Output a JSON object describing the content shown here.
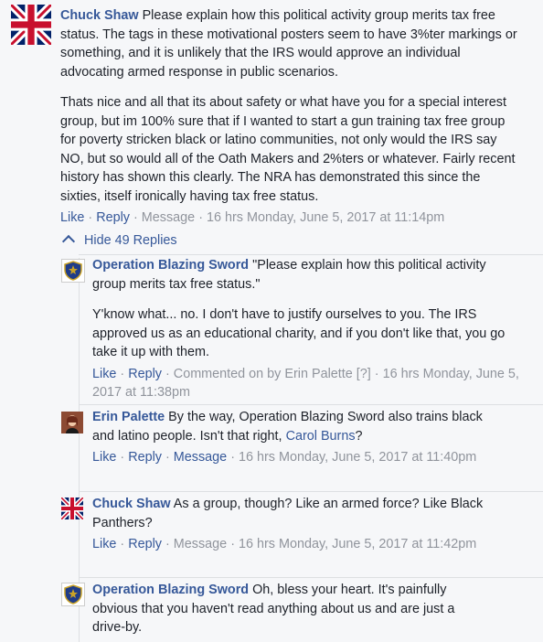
{
  "comments": {
    "c1": {
      "author": "Chuck Shaw",
      "text_para1": " Please explain how this political activity group merits tax free status. The tags in these motivational posters seem to have 3%ter markings or something, and it is unlikely that the IRS would approve an individual advocating armed response in public scenarios.",
      "text_para2": "Thats nice and all that its about safety or what have you for a special interest group, but im 100% sure that if I wanted to start a gun training tax free group for poverty stricken black or latino communities, not only would the IRS say NO, but so would all of the Oath Makers and 2%ters or whatever. Fairly recent history has shown this clearly. The NRA has demonstrated this since the sixties, itself ironically having tax free status.",
      "actions": {
        "like": "Like",
        "reply": "Reply",
        "message": "Message",
        "age": "16 hrs",
        "timestamp": "Monday, June 5, 2017 at 11:14pm"
      }
    },
    "hide_replies": "Hide 49 Replies",
    "r1": {
      "author": "Operation Blazing Sword",
      "text_para1": " \"Please explain how this political activity group merits tax free status.\"",
      "text_para2": "Y'know what... no. I don't have to justify ourselves to you. The IRS approved us as an educational charity, and if you don't like that, you go take it up with them.",
      "actions": {
        "like": "Like",
        "reply": "Reply",
        "commented_on_by": "Commented on by Erin Palette [?]",
        "age": "16 hrs",
        "timestamp": "Monday, June 5, 2017 at 11:38pm"
      }
    },
    "r2": {
      "author": "Erin Palette",
      "text": " By the way, Operation Blazing Sword also trains black and latino people. Isn't that right, ",
      "mention": "Carol Burns",
      "text_end": "?",
      "actions": {
        "like": "Like",
        "reply": "Reply",
        "message": "Message",
        "age": "16 hrs",
        "timestamp": "Monday, June 5, 2017 at 11:40pm"
      }
    },
    "r3": {
      "author": "Chuck Shaw",
      "text": " As a group, though? Like an armed force? Like Black Panthers?",
      "actions": {
        "like": "Like",
        "reply": "Reply",
        "message": "Message",
        "age": "16 hrs",
        "timestamp": "Monday, June 5, 2017 at 11:42pm"
      }
    },
    "r4": {
      "author": "Operation Blazing Sword",
      "text": " Oh, bless your heart. It's painfully obvious that you haven't read anything about us and are just a drive-by."
    }
  },
  "separator": "·",
  "colors": {
    "link": "#365899",
    "meta": "#90949c",
    "thread_line": "#dddfe2"
  },
  "icons": {
    "uk_flag": "union-jack-avatar",
    "shield": "shield-badge-avatar",
    "person": "person-photo-avatar",
    "chevron": "chevron-up-icon"
  }
}
